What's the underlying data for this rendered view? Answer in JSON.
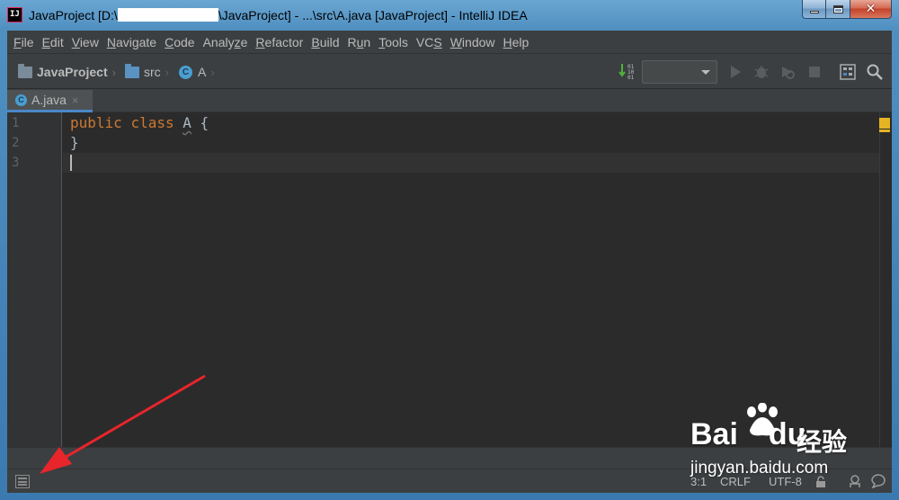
{
  "window": {
    "title_prefix": "JavaProject [D:\\",
    "title_suffix": "\\JavaProject] - ...\\src\\A.java [JavaProject] - IntelliJ IDEA",
    "app_logo": "IJ"
  },
  "menu": {
    "items": [
      {
        "mnemonic": "F",
        "rest": "ile"
      },
      {
        "mnemonic": "E",
        "rest": "dit"
      },
      {
        "mnemonic": "V",
        "rest": "iew"
      },
      {
        "mnemonic": "N",
        "rest": "avigate"
      },
      {
        "mnemonic": "C",
        "rest": "ode"
      },
      {
        "pre": "Analy",
        "mnemonic": "z",
        "rest": "e"
      },
      {
        "mnemonic": "R",
        "rest": "efactor"
      },
      {
        "mnemonic": "B",
        "rest": "uild"
      },
      {
        "pre": "R",
        "mnemonic": "u",
        "rest": "n"
      },
      {
        "mnemonic": "T",
        "rest": "ools"
      },
      {
        "pre": "VC",
        "mnemonic": "S",
        "rest": ""
      },
      {
        "mnemonic": "W",
        "rest": "indow"
      },
      {
        "mnemonic": "H",
        "rest": "elp"
      }
    ]
  },
  "breadcrumb": {
    "project": "JavaProject",
    "folder": "src",
    "file_class": "A",
    "separator": "›"
  },
  "toolbar": {
    "run_config_value": "",
    "icons": [
      "sort-icon",
      "run-icon",
      "debug-icon",
      "coverage-icon",
      "stop-icon",
      "project-structure-icon",
      "search-icon"
    ]
  },
  "tabs": [
    {
      "label": "A.java",
      "close": "×"
    }
  ],
  "editor": {
    "line_numbers": [
      "1",
      "2",
      "3"
    ],
    "lines": [
      {
        "kw1": "public",
        "kw2": "class",
        "name": "A",
        "brace": "{"
      },
      {
        "brace": "}"
      },
      {}
    ],
    "colors": {
      "keyword": "#cc7832",
      "text": "#a9b7c6",
      "warning": "#e6b422"
    }
  },
  "status": {
    "position": "3:1",
    "line_separator": "CRLF",
    "encoding": "UTF-8"
  },
  "watermark": {
    "brand_en": "Bai",
    "brand_du": "du",
    "brand_cn": "经验",
    "url": "jingyan.baidu.com"
  }
}
